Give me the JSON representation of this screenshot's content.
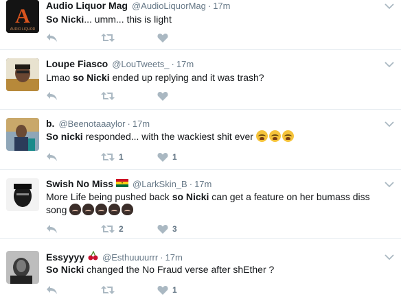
{
  "tweets": [
    {
      "fullname": "Audio Liquor Mag",
      "handle": "@AudioLiquorMag",
      "dot": "·",
      "time": "17m",
      "text_bold": "So Nicki",
      "text_rest": "... umm... this is light",
      "retweet_count": "",
      "like_count": "",
      "avatar_icon": "audio-liquor-logo",
      "avatar_letter": "A",
      "avatar_caption": "AUDIO LIQUOR"
    },
    {
      "fullname": "Loupe Fiasco",
      "handle": "@LouTweets_",
      "dot": "·",
      "time": "17m",
      "text_pre": "Lmao ",
      "text_bold": "so Nicki",
      "text_rest": " ended up replying and it was trash?",
      "retweet_count": "",
      "like_count": "",
      "avatar_icon": "user-photo"
    },
    {
      "fullname": "b.",
      "handle": "@Beenotaaaylor",
      "dot": "·",
      "time": "17m",
      "text_bold": "So nicki",
      "text_rest": " responded... with the wackiest shit ever ",
      "emojis": [
        "loudly-crying-face",
        "loudly-crying-face",
        "loudly-crying-face"
      ],
      "retweet_count": "1",
      "like_count": "1",
      "avatar_icon": "user-photo"
    },
    {
      "fullname": "Swish No Miss",
      "name_emoji": "ghana-flag",
      "handle": "@LarkSkin_B",
      "dot": "·",
      "time": "17m",
      "text_pre": "More Life being pushed back ",
      "text_bold": "so Nicki",
      "text_rest": " can get a feature on her bumass diss song ",
      "emojis": [
        "face-palm",
        "face-palm",
        "face-palm",
        "face-palm",
        "face-palm"
      ],
      "retweet_count": "2",
      "like_count": "3",
      "avatar_icon": "user-photo"
    },
    {
      "fullname": "Essyyyy",
      "name_emoji": "cherries",
      "handle": "@Esthuuuurrr",
      "dot": "·",
      "time": "17m",
      "text_bold": "So Nicki",
      "text_rest": " changed the No Fraud verse after shEther ?",
      "retweet_count": "",
      "like_count": "1",
      "avatar_icon": "user-photo"
    }
  ],
  "icons": {
    "reply": "reply-icon",
    "retweet": "retweet-icon",
    "like": "heart-icon",
    "more": "chevron-down-icon"
  },
  "colors": {
    "text": "#14171a",
    "muted": "#657786",
    "icon": "#aab8c2",
    "border": "#e6ecf0"
  }
}
